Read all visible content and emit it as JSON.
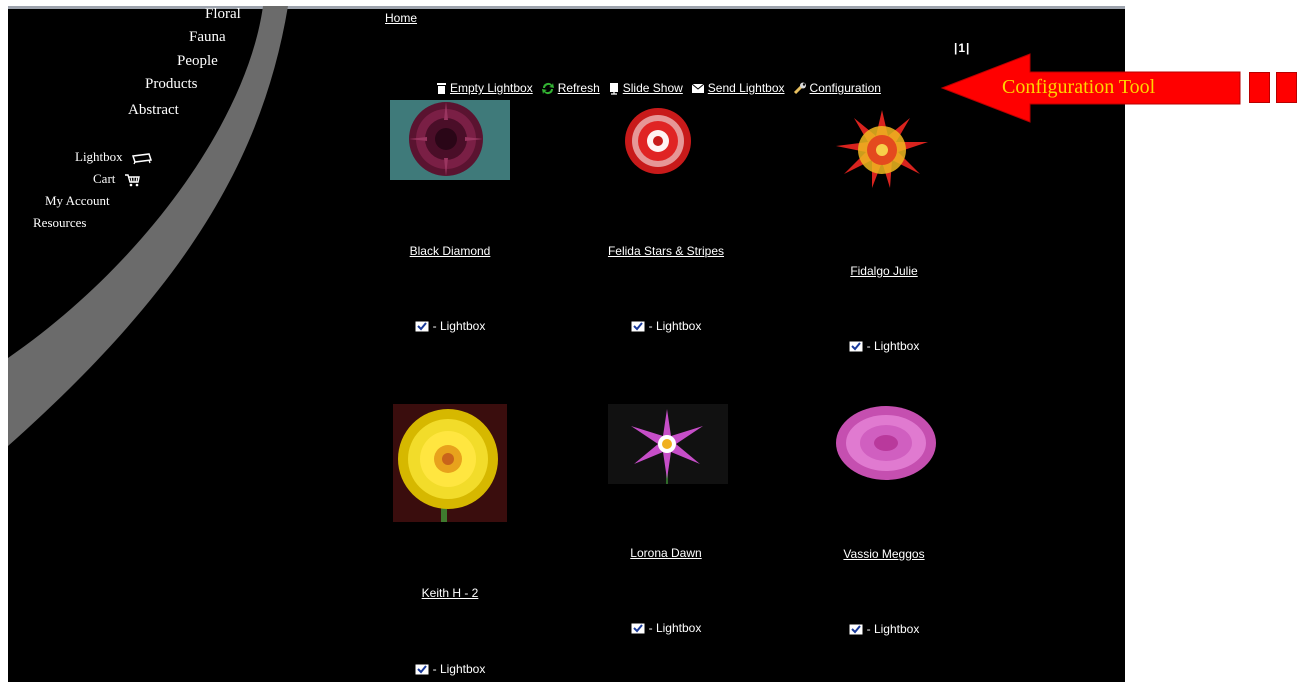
{
  "nav": {
    "categories": [
      "Floral",
      "Fauna",
      "People",
      "Products",
      "Abstract"
    ],
    "lightbox": "Lightbox",
    "cart": "Cart",
    "my_account": "My Account",
    "resources": "Resources"
  },
  "breadcrumb": {
    "home": "Home"
  },
  "pager": {
    "current": "1"
  },
  "toolbar": {
    "empty_lightbox": "Empty Lightbox",
    "refresh": "Refresh",
    "slide_show": "Slide Show",
    "send_lightbox": "Send Lightbox",
    "configuration": "Configuration"
  },
  "items": [
    {
      "title": "Black Diamond",
      "lightbox_label": "- Lightbox"
    },
    {
      "title": "Felida Stars & Stripes",
      "lightbox_label": "- Lightbox"
    },
    {
      "title": "Fidalgo Julie",
      "lightbox_label": "- Lightbox"
    },
    {
      "title": "Keith H - 2",
      "lightbox_label": "- Lightbox"
    },
    {
      "title": "Lorona Dawn",
      "lightbox_label": "- Lightbox"
    },
    {
      "title": "Vassio Meggos",
      "lightbox_label": "- Lightbox"
    }
  ],
  "annotation": {
    "text": "Configuration Tool"
  },
  "colors": {
    "page_bg": "#000000",
    "accent_red": "#ff0000",
    "annotation_text": "#ffd400",
    "arc": "#6b6b6b"
  }
}
